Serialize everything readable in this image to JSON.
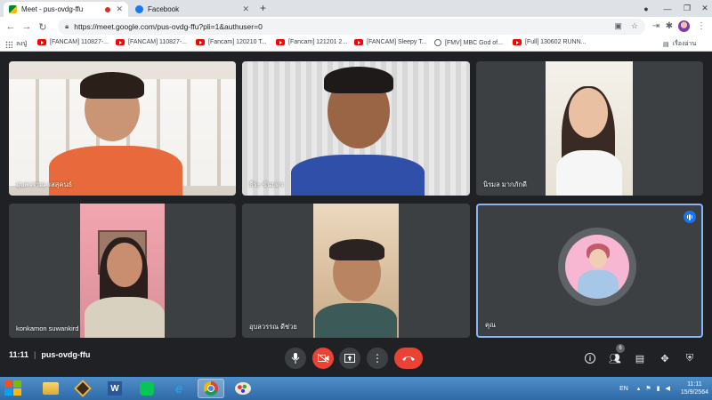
{
  "browser": {
    "tabs": [
      {
        "title": "Meet - pus-ovdg-ffu",
        "active": true
      },
      {
        "title": "Facebook",
        "active": false
      }
    ],
    "url": "https://meet.google.com/pus-ovdg-ffu?pli=1&authuser=0",
    "bookmarks": [
      {
        "label": "ลงปู่",
        "icon": "apps-icon"
      },
      {
        "label": "[FANCAM] 110827-...",
        "icon": "youtube-icon"
      },
      {
        "label": "[FANCAM] 110827-...",
        "icon": "youtube-icon"
      },
      {
        "label": "[Fancam] 120210 T...",
        "icon": "youtube-icon"
      },
      {
        "label": "[Fancam] 121201 2...",
        "icon": "youtube-icon"
      },
      {
        "label": "[FANCAM] Sleepy T...",
        "icon": "youtube-icon"
      },
      {
        "label": "[FMV] MBC God of...",
        "icon": "globe-icon"
      },
      {
        "label": "[Full] 130602 RUNN...",
        "icon": "youtube-icon"
      }
    ],
    "reading_list": "เรื่องอ่าน"
  },
  "meet": {
    "participants": [
      {
        "name": "อุบลวรรณ รสสุคนธ์"
      },
      {
        "name": "ธีระ ขันบดร"
      },
      {
        "name": "นิรมล มากภักดี"
      },
      {
        "name": "konkamon suwankird"
      },
      {
        "name": "อุบลวรรณ ดีช่วย"
      },
      {
        "name": "คุณ"
      }
    ],
    "time": "11:11",
    "separator": "|",
    "meeting_code": "pus-ovdg-ffu",
    "participant_count": "6"
  },
  "taskbar": {
    "language": "EN",
    "clock_time": "11:11",
    "clock_date": "15/9/2564"
  },
  "colors": {
    "meet_bg": "#202124",
    "tile_bg": "#3c4043",
    "red": "#ea4335",
    "selected": "#8ab4f8"
  }
}
